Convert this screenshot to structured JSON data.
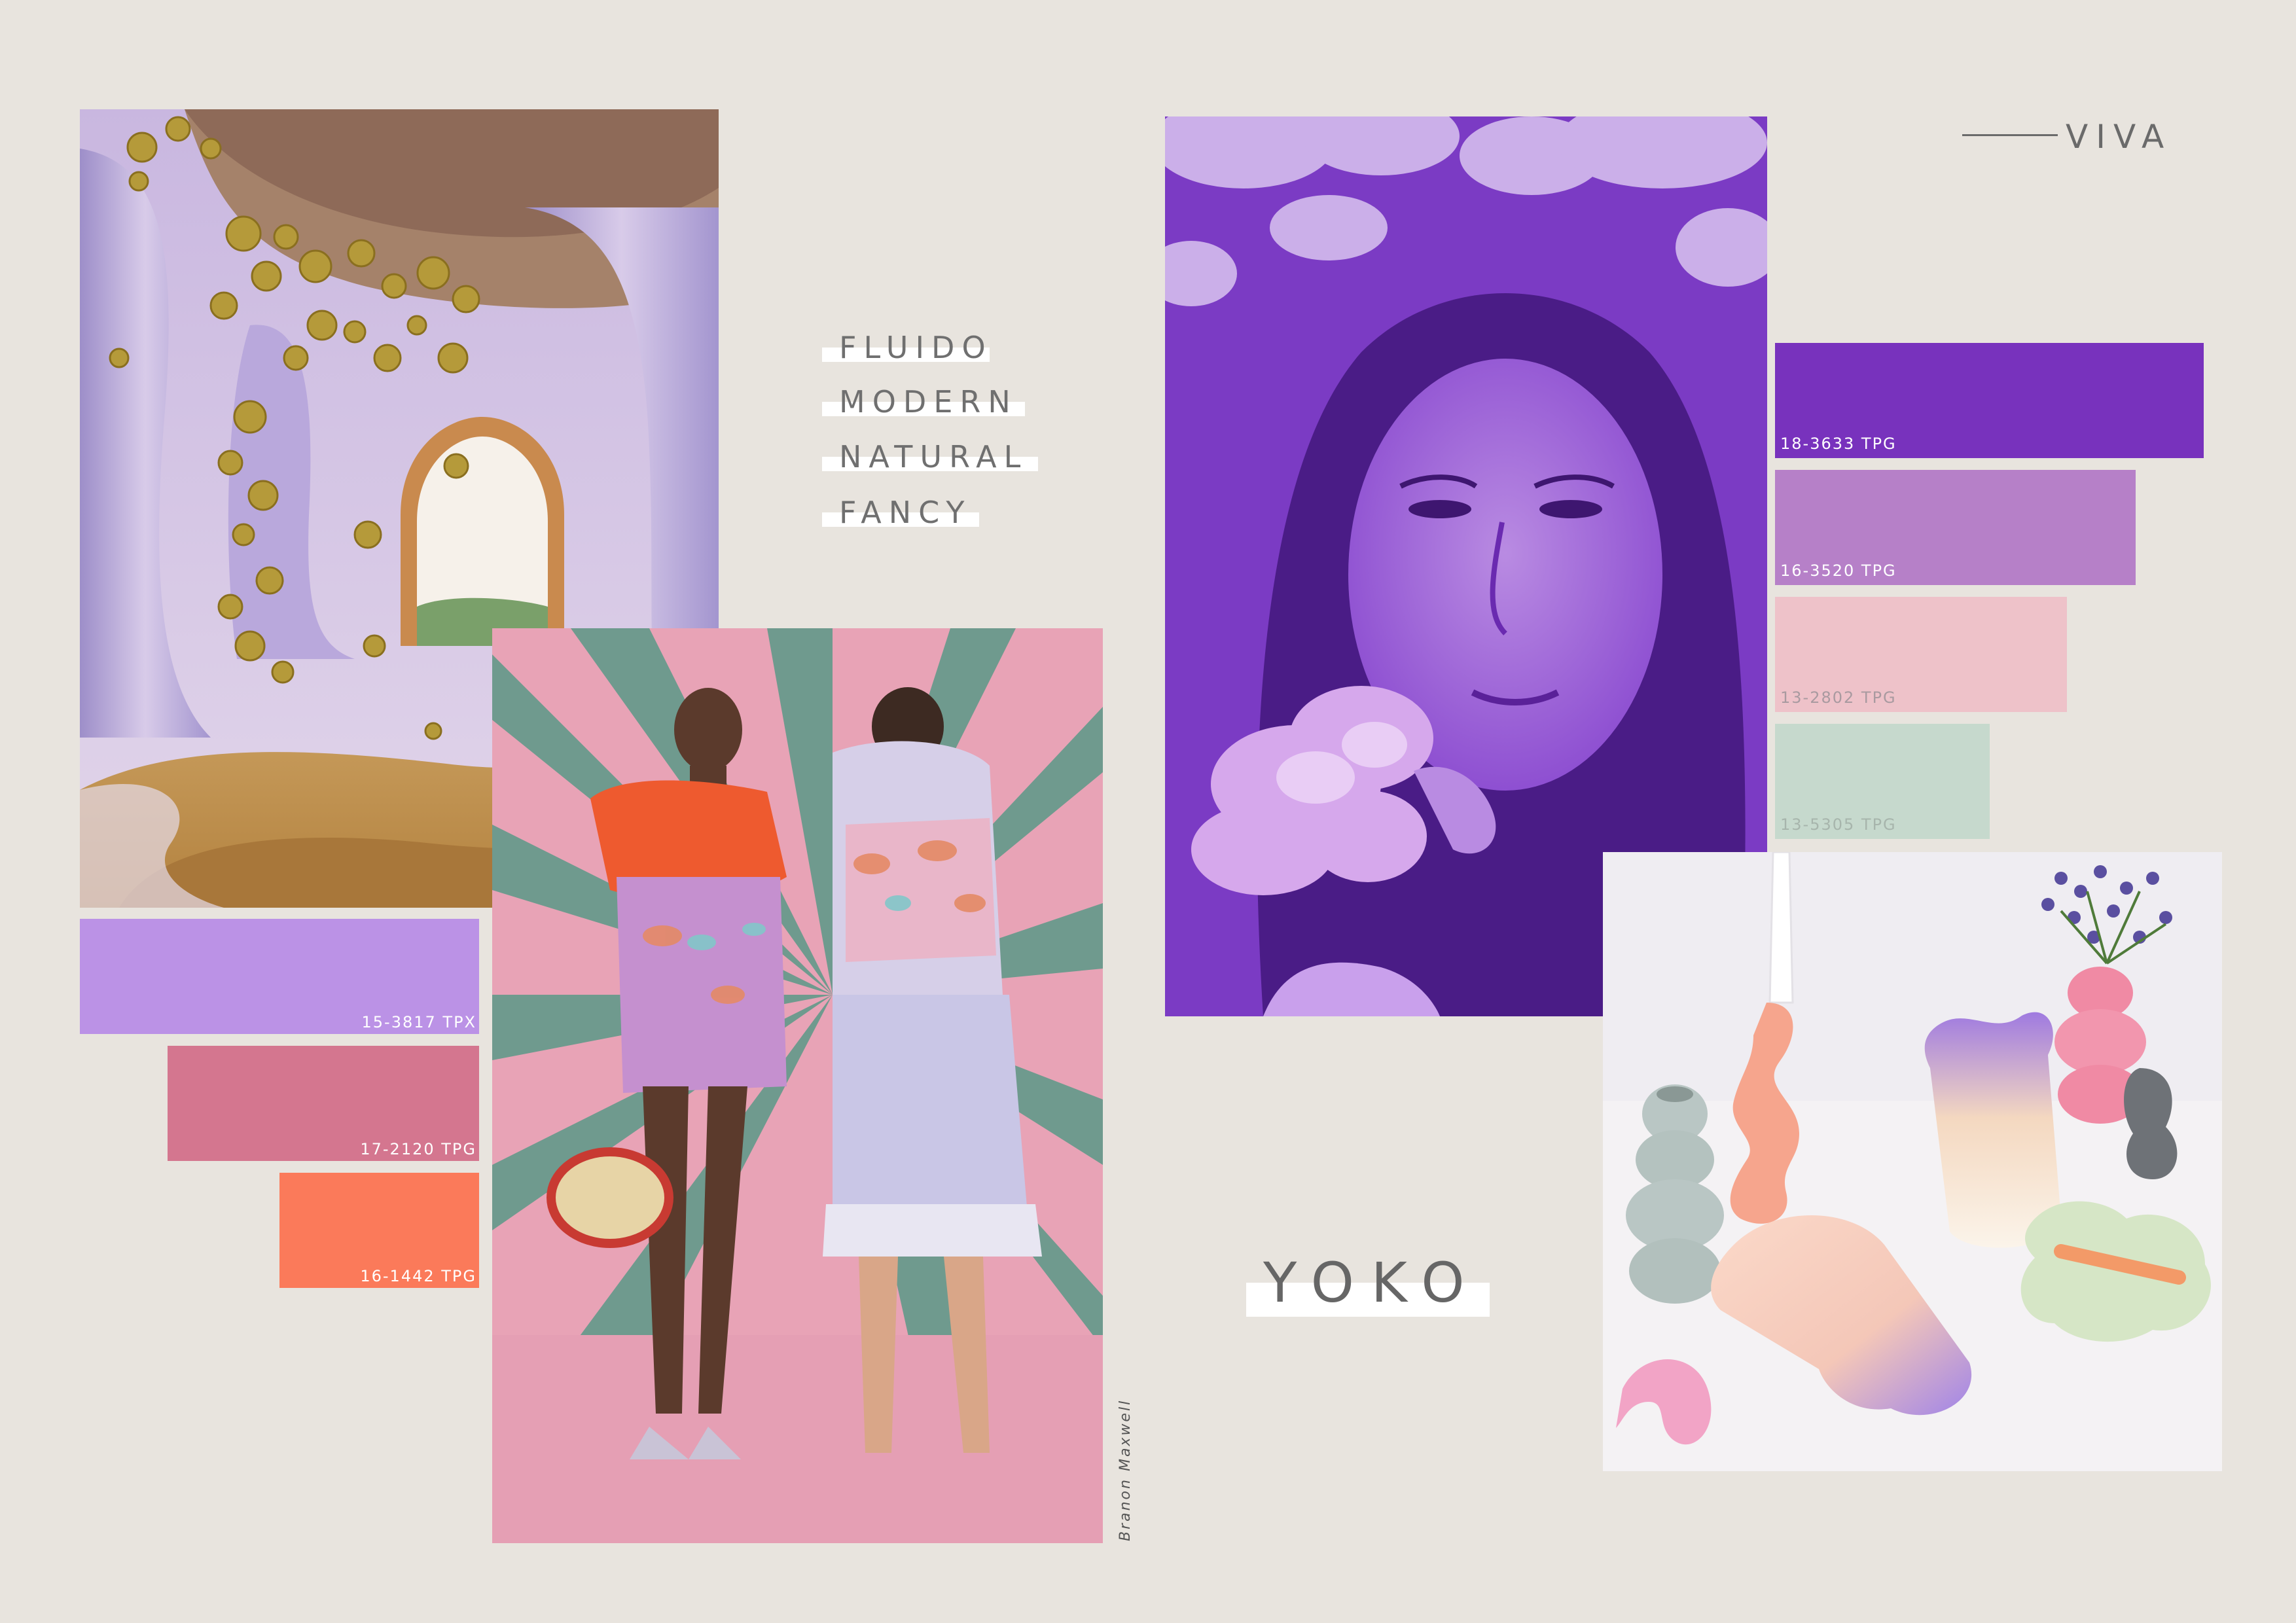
{
  "keywords": [
    "FLUIDO",
    "MODERN",
    "NATURAL",
    "FANCY"
  ],
  "title": "YOKO",
  "corner_label": "VIVA",
  "photo_credit": "Branon Maxwell",
  "palette_left": [
    {
      "code": "15-3817 TPX",
      "color": "#bb92e6",
      "text_color": "#ffffff"
    },
    {
      "code": "17-2120 TPG",
      "color": "#d4768f",
      "text_color": "#ffffff"
    },
    {
      "code": "16-1442 TPG",
      "color": "#fb7a5a",
      "text_color": "#ffffff"
    }
  ],
  "palette_right": [
    {
      "code": "18-3633 TPG",
      "color": "#7832bd",
      "text_color": "#ffffff"
    },
    {
      "code": "16-3520 TPG",
      "color": "#b680c8",
      "text_color": "#ffffff"
    },
    {
      "code": "13-2802 TPG",
      "color": "#eec2c9",
      "text_color": "#a99aa0"
    },
    {
      "code": "13-5305 TPG",
      "color": "#c6d9cd",
      "text_color": "#a7b5ac"
    }
  ],
  "photos": [
    {
      "name": "architecture-photo",
      "subject": "surreal-architecture"
    },
    {
      "name": "fashion-photo",
      "subject": "fashion-models"
    },
    {
      "name": "portrait-photo",
      "subject": "purple-duotone-portrait"
    },
    {
      "name": "ceramics-photo",
      "subject": "pastel-ceramic-vases"
    }
  ]
}
